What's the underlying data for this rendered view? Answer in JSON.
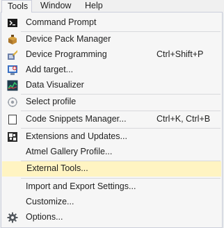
{
  "menubar": {
    "items": [
      {
        "label": "Tools",
        "active": true
      },
      {
        "label": "Window",
        "active": false
      },
      {
        "label": "Help",
        "active": false
      }
    ]
  },
  "menu": {
    "items": [
      {
        "label": "Command Prompt",
        "shortcut": "",
        "icon": "command-prompt-icon"
      },
      {
        "label": "Device Pack Manager",
        "shortcut": "",
        "icon": "package-icon"
      },
      {
        "label": "Device Programming",
        "shortcut": "Ctrl+Shift+P",
        "icon": "device-programming-icon"
      },
      {
        "label": "Add target...",
        "shortcut": "",
        "icon": "add-target-icon"
      },
      {
        "label": "Data Visualizer",
        "shortcut": "",
        "icon": "data-visualizer-icon"
      },
      {
        "label": "Select profile",
        "shortcut": "",
        "icon": "profile-icon"
      },
      {
        "label": "Code Snippets Manager...",
        "shortcut": "Ctrl+K, Ctrl+B",
        "icon": "snippets-icon"
      },
      {
        "label": "Extensions and Updates...",
        "shortcut": "",
        "icon": "extensions-icon"
      },
      {
        "label": "Atmel Gallery Profile...",
        "shortcut": "",
        "icon": ""
      },
      {
        "label": "External Tools...",
        "shortcut": "",
        "icon": "",
        "highlighted": true
      },
      {
        "label": "Import and Export Settings...",
        "shortcut": "",
        "icon": ""
      },
      {
        "label": "Customize...",
        "shortcut": "",
        "icon": ""
      },
      {
        "label": "Options...",
        "shortcut": "",
        "icon": "gear-icon"
      }
    ]
  },
  "colors": {
    "highlight": "#fff4c2",
    "menu_background": "#f6f6f6",
    "menu_border": "#cccedb"
  }
}
